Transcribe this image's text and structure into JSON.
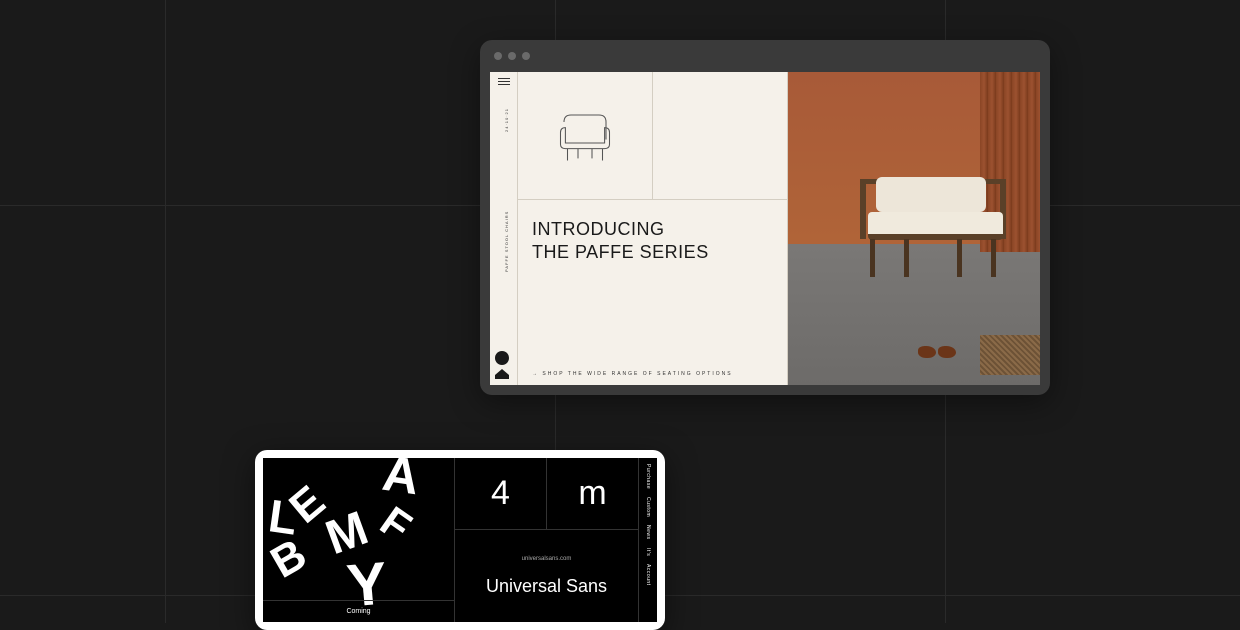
{
  "window1": {
    "heading_line1": "INTRODUCING",
    "heading_line2": "THE PAFFE SERIES",
    "footer_text": "→ SHOP THE WIDE RANGE OF SEATING OPTIONS",
    "vertical_text_1": "24·10·21",
    "vertical_text_2": "PAFFE STOOL CHAIRS"
  },
  "window2": {
    "scattered_letters": [
      "A",
      "E",
      "M",
      "F",
      "L",
      "B",
      "Y"
    ],
    "left_footer": "Coming",
    "cell_number": "4",
    "cell_letter": "m",
    "url": "universalsans.com",
    "font_name": "Universal Sans",
    "nav": [
      "Purchase",
      "Custom",
      "News",
      "It's",
      "Account"
    ]
  }
}
